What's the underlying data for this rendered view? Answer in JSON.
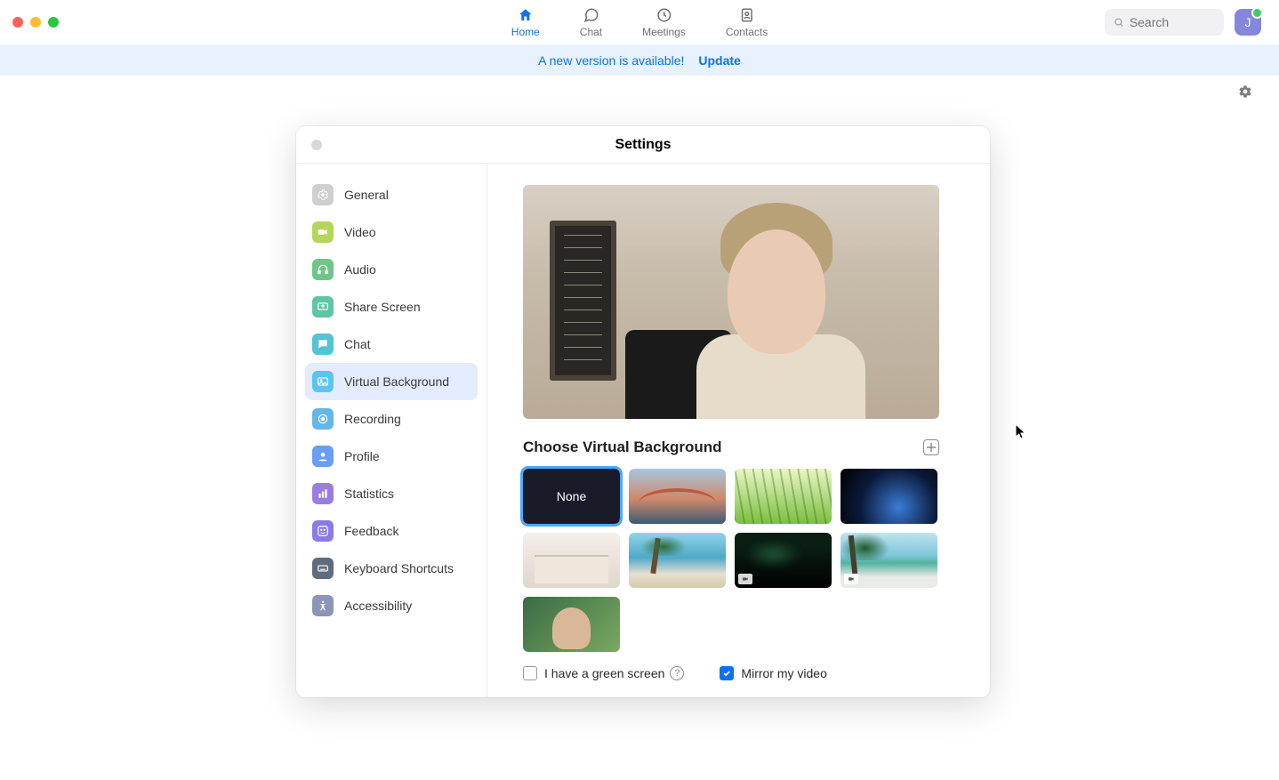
{
  "nav": {
    "tabs": [
      {
        "id": "home",
        "label": "Home",
        "active": true
      },
      {
        "id": "chat",
        "label": "Chat",
        "active": false
      },
      {
        "id": "meetings",
        "label": "Meetings",
        "active": false
      },
      {
        "id": "contacts",
        "label": "Contacts",
        "active": false
      }
    ],
    "search_placeholder": "Search",
    "avatar_initial": "J"
  },
  "banner": {
    "message": "A new version is available!",
    "action": "Update"
  },
  "settings": {
    "title": "Settings",
    "sidebar": [
      {
        "id": "general",
        "label": "General",
        "icon": "gear",
        "color": "si-gray",
        "active": false
      },
      {
        "id": "video",
        "label": "Video",
        "icon": "video",
        "color": "si-lime",
        "active": false
      },
      {
        "id": "audio",
        "label": "Audio",
        "icon": "headphones",
        "color": "si-green",
        "active": false
      },
      {
        "id": "share",
        "label": "Share Screen",
        "icon": "share",
        "color": "si-teal",
        "active": false
      },
      {
        "id": "chat",
        "label": "Chat",
        "icon": "chat",
        "color": "si-cyan",
        "active": false
      },
      {
        "id": "vbg",
        "label": "Virtual Background",
        "icon": "image",
        "color": "si-sky",
        "active": true
      },
      {
        "id": "recording",
        "label": "Recording",
        "icon": "record",
        "color": "si-rec",
        "active": false
      },
      {
        "id": "profile",
        "label": "Profile",
        "icon": "person",
        "color": "si-blue",
        "active": false
      },
      {
        "id": "stats",
        "label": "Statistics",
        "icon": "stats",
        "color": "si-purple",
        "active": false
      },
      {
        "id": "feedback",
        "label": "Feedback",
        "icon": "smile",
        "color": "si-violet",
        "active": false
      },
      {
        "id": "shortcuts",
        "label": "Keyboard Shortcuts",
        "icon": "keyboard",
        "color": "si-dark",
        "active": false
      },
      {
        "id": "access",
        "label": "Accessibility",
        "icon": "access",
        "color": "si-slate",
        "active": false
      }
    ],
    "vbg": {
      "section_title": "Choose Virtual Background",
      "none_label": "None",
      "thumbs": [
        {
          "id": "none",
          "kind": "none",
          "selected": true,
          "video": false
        },
        {
          "id": "bridge",
          "kind": "image",
          "selected": false,
          "video": false,
          "class": "bg-bridge"
        },
        {
          "id": "grass",
          "kind": "image",
          "selected": false,
          "video": false,
          "class": "bg-grass"
        },
        {
          "id": "earth",
          "kind": "image",
          "selected": false,
          "video": false,
          "class": "bg-earth"
        },
        {
          "id": "room",
          "kind": "image",
          "selected": false,
          "video": false,
          "class": "bg-room"
        },
        {
          "id": "palm",
          "kind": "image",
          "selected": false,
          "video": false,
          "class": "bg-palm"
        },
        {
          "id": "aurora",
          "kind": "video",
          "selected": false,
          "video": true,
          "class": "bg-aurora"
        },
        {
          "id": "beach",
          "kind": "video",
          "selected": false,
          "video": true,
          "class": "bg-beach"
        },
        {
          "id": "person",
          "kind": "image",
          "selected": false,
          "video": false,
          "class": "bg-person"
        }
      ],
      "green_screen_label": "I have a green screen",
      "green_screen_checked": false,
      "mirror_label": "Mirror my video",
      "mirror_checked": true
    }
  }
}
